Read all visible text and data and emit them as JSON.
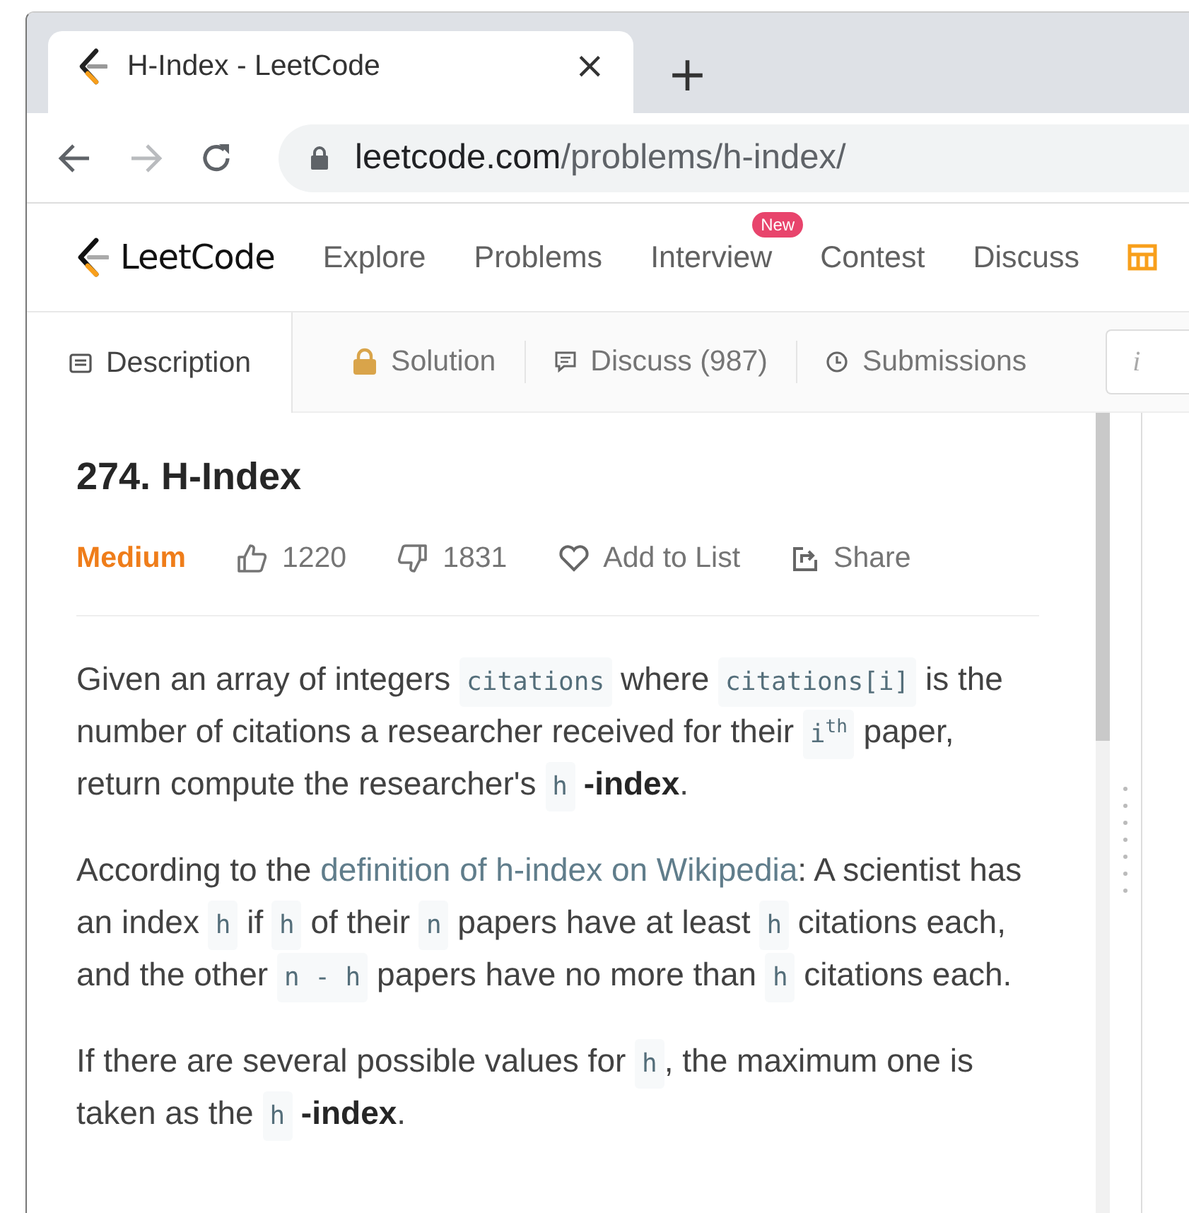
{
  "browser": {
    "tab_title": "H-Index - LeetCode",
    "close": "×",
    "new_tab": "+",
    "forward_enabled": false,
    "url_host": "leetcode.com",
    "url_path": "/problems/h-index/"
  },
  "nav": {
    "logo": "LeetCode",
    "items": [
      {
        "label": "Explore"
      },
      {
        "label": "Problems"
      },
      {
        "label": "Interview",
        "badge": "New"
      },
      {
        "label": "Contest"
      },
      {
        "label": "Discuss"
      }
    ]
  },
  "tabs": [
    {
      "label": "Description",
      "kind": "description",
      "selected": true
    },
    {
      "label": "Solution",
      "kind": "solution",
      "selected": false
    },
    {
      "label": "Discuss (987)",
      "kind": "discuss",
      "selected": false
    },
    {
      "label": "Submissions",
      "kind": "submissions",
      "selected": false
    }
  ],
  "side_button": "i",
  "problem": {
    "title": "274. H-Index",
    "difficulty": "Medium",
    "likes": "1220",
    "dislikes": "1831",
    "actions": [
      {
        "label": "Add to List",
        "kind": "add"
      },
      {
        "label": "Share",
        "kind": "share"
      }
    ]
  },
  "paragraphs": [
    [
      {
        "kind": "text",
        "text": "Given an array of integers "
      },
      {
        "kind": "code",
        "text": "citations"
      },
      {
        "kind": "text",
        "text": " where "
      },
      {
        "kind": "code",
        "text": "citations[i]"
      },
      {
        "kind": "text",
        "text": " is the number of citations a researcher received for their "
      },
      {
        "kind": "code",
        "text": "i$^{th}$"
      },
      {
        "kind": "text",
        "text": " paper, return compute the researcher's "
      },
      {
        "kind": "code",
        "text": "h"
      },
      {
        "kind": "bold",
        "text": " -index"
      },
      {
        "kind": "text",
        "text": "."
      }
    ],
    [
      {
        "kind": "text",
        "text": "According to the "
      },
      {
        "kind": "link",
        "text": "definition of h-index on Wikipedia"
      },
      {
        "kind": "text",
        "text": ": A scientist has an index "
      },
      {
        "kind": "code",
        "text": "h"
      },
      {
        "kind": "text",
        "text": " if "
      },
      {
        "kind": "code",
        "text": "h"
      },
      {
        "kind": "text",
        "text": " of their "
      },
      {
        "kind": "code",
        "text": "n"
      },
      {
        "kind": "text",
        "text": " papers have at least "
      },
      {
        "kind": "code",
        "text": "h"
      },
      {
        "kind": "text",
        "text": " citations each, and the other "
      },
      {
        "kind": "code",
        "text": "n - h"
      },
      {
        "kind": "text",
        "text": " papers have no more than "
      },
      {
        "kind": "code",
        "text": "h"
      },
      {
        "kind": "text",
        "text": " citations each."
      }
    ],
    [
      {
        "kind": "text",
        "text": "If there are several possible values for "
      },
      {
        "kind": "code",
        "text": "h"
      },
      {
        "kind": "text",
        "text": ", the maximum one is taken as the "
      },
      {
        "kind": "code",
        "text": "h"
      },
      {
        "kind": "bold",
        "text": " -index"
      },
      {
        "kind": "text",
        "text": "."
      }
    ]
  ]
}
